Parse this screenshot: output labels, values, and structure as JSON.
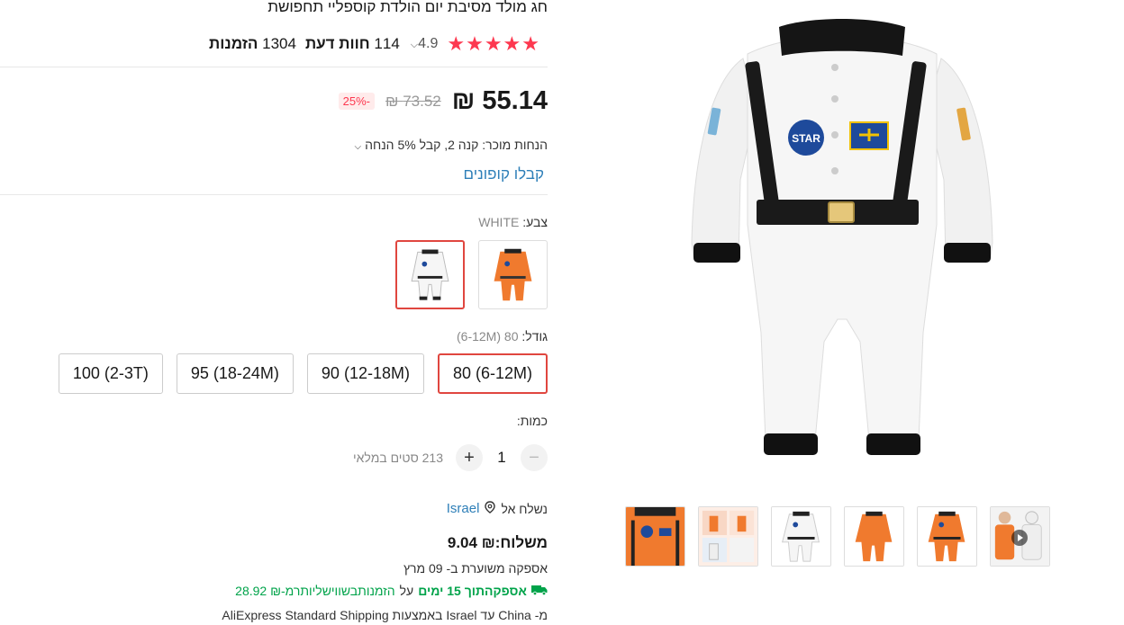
{
  "product": {
    "title": "חג מולד מסיבת יום הולדת קוספליי תחפושת",
    "rating": "4.9",
    "reviews_count": "114",
    "reviews_label": "חוות דעת",
    "orders_count": "1304",
    "orders_label": "הזמנות"
  },
  "price": {
    "current": "55.14 ₪",
    "original": "73.52 ₪",
    "discount": "-25%"
  },
  "promo": {
    "text": "הנחות מוכר: קנה 2, קבל 5% הנחה",
    "coupons_link": "קבלו קופונים"
  },
  "color": {
    "label": "צבע:",
    "selected": "WHITE",
    "options": [
      "orange",
      "white"
    ]
  },
  "size": {
    "label": "גודל:",
    "selected": "80 (6-12M)",
    "options": [
      "80 (6-12M)",
      "90 (12-18M)",
      "95 (18-24M)",
      "100 (2-3T)"
    ]
  },
  "quantity": {
    "label": "כמות:",
    "value": "1",
    "stock": "213 סטים במלאי"
  },
  "shipping": {
    "ship_to_label": "נשלח אל",
    "country": "Israel",
    "cost": "משלוח:₪ 9.04",
    "delivery": "אספקה משוערת ב- 09 מרץ",
    "fast_prefix": "אספקהתוך 15 ימים",
    "fast_mid": "על",
    "fast_suffix": "הזמנותבשווישליותרמ-₪ 28.92",
    "method": "מ- China עד Israel באמצעות AliExpress Standard Shipping"
  },
  "gallery": {
    "thumbnails": [
      "orange-closeup",
      "collage",
      "white-suit",
      "orange-suit-back",
      "orange-suit",
      "kids-video"
    ]
  },
  "colors": {
    "accent": "#fd384f",
    "link": "#2e7fb8",
    "green": "#00a34a",
    "selected_border": "#e0463f"
  }
}
